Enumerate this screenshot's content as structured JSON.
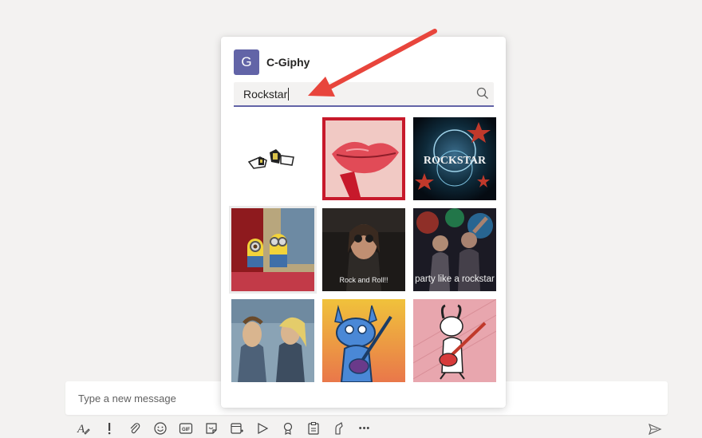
{
  "compose": {
    "placeholder": "Type a new message",
    "toolbar": [
      "format-icon",
      "important-icon",
      "attach-icon",
      "emoji-icon",
      "gif-icon",
      "sticker-icon",
      "schedule-meeting-icon",
      "stream-icon",
      "praise-icon",
      "clipboard-icon",
      "approvals-icon",
      "more-options-icon"
    ],
    "gif_badge": "GIF",
    "more": "•••"
  },
  "giphy": {
    "app_initial": "G",
    "app_name": "C-Giphy",
    "search_value": "Rockstar",
    "results": [
      {
        "name": "gif-result-rock-hands",
        "caption": ""
      },
      {
        "name": "gif-result-red-lips",
        "caption": ""
      },
      {
        "name": "gif-result-rockstar-logo",
        "caption": "ROCKSTAR"
      },
      {
        "name": "gif-result-minions",
        "caption": ""
      },
      {
        "name": "gif-result-rock-and-roll",
        "caption": "Rock and Roll!!"
      },
      {
        "name": "gif-result-party-rockstar",
        "caption": "party like a rockstar"
      },
      {
        "name": "gif-result-beavis-butthead",
        "caption": ""
      },
      {
        "name": "gif-result-blue-guitarist",
        "caption": ""
      },
      {
        "name": "gif-result-snoopy-guitar",
        "caption": ""
      }
    ]
  },
  "colors": {
    "accent": "#6264a7",
    "annotation_arrow": "#e8453c"
  }
}
